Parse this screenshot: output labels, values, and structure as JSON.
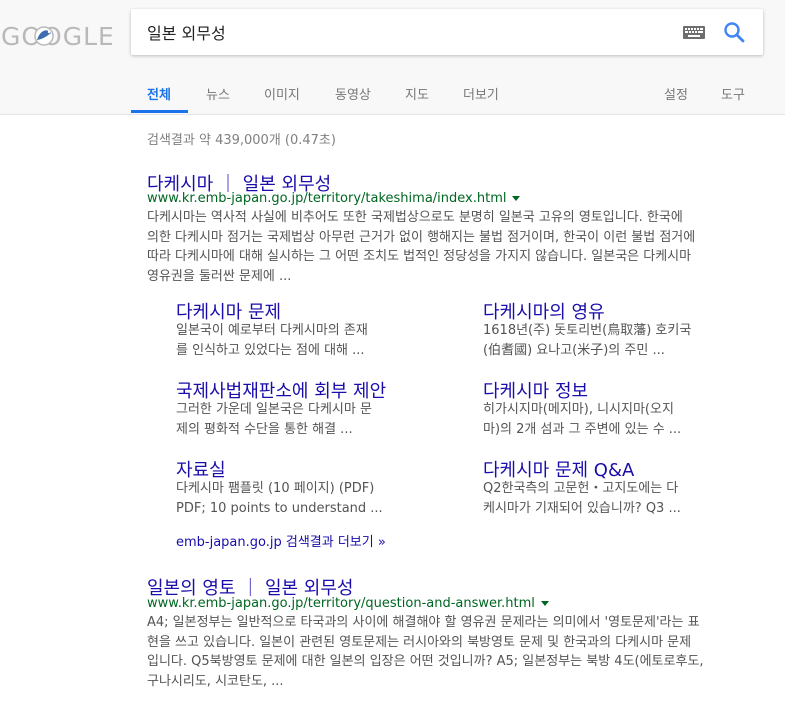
{
  "logo": {
    "text": "GOOGLE"
  },
  "search": {
    "query": "일본 외무성"
  },
  "tabs": [
    {
      "label": "전체",
      "active": true
    },
    {
      "label": "뉴스"
    },
    {
      "label": "이미지"
    },
    {
      "label": "동영상"
    },
    {
      "label": "지도"
    },
    {
      "label": "더보기"
    },
    {
      "label": "설정"
    },
    {
      "label": "도구"
    }
  ],
  "stats": "검색결과 약 439,000개 (0.47초)",
  "results": [
    {
      "title": "다케시마 ｜ 일본 외무성",
      "url": "www.kr.emb-japan.go.jp/territory/takeshima/index.html",
      "snippet": [
        "다케시마는 역사적 사실에 비추어도 또한 국제법상으로도 분명히 일본국 고유의 영토입니다. 한국에",
        "의한 다케시마 점거는 국제법상 아무런 근거가 없이 행해지는 불법 점거이며, 한국이 이런 불법 점거에",
        "따라 다케시마에 대해 실시하는 그 어떤 조치도 법적인 정당성을 가지지 않습니다. 일본국은 다케시마",
        "영유권을 둘러싼 문제에 ..."
      ],
      "sitelinks": [
        {
          "title": "다케시마 문제",
          "desc": [
            "일본국이 예로부터 다케시마의 존재",
            "를 인식하고 있었다는 점에 대해 ..."
          ]
        },
        {
          "title": "다케시마의 영유",
          "desc": [
            "1618년(주) 돗토리번(鳥取藩) 호키국",
            "(伯耆國) 요나고(米子)의 주민 ..."
          ]
        },
        {
          "title": "국제사법재판소에 회부 제안",
          "desc": [
            "그러한 가운데 일본국은 다케시마 문",
            "제의 평화적 수단을 통한 해결 ..."
          ]
        },
        {
          "title": "다케시마 정보",
          "desc": [
            "히가시지마(메지마), 니시지마(오지",
            "마)의 2개 섬과 그 주변에 있는 수 ..."
          ]
        },
        {
          "title": "자료실",
          "desc": [
            "다케시마 팸플릿 (10 페이지) (PDF)",
            "PDF; 10 points to understand ..."
          ]
        },
        {
          "title": "다케시마 문제 Q&A",
          "desc": [
            "Q2한국측의 고문헌・고지도에는 다",
            "케시마가 기재되어 있습니까? Q3 ..."
          ]
        }
      ],
      "more": "emb-japan.go.jp 검색결과 더보기 »"
    },
    {
      "title": "일본의 영토 ｜ 일본 외무성",
      "url": "www.kr.emb-japan.go.jp/territory/question-and-answer.html",
      "snippet": [
        "A4; 일본정부는 일반적으로 타국과의 사이에 해결해야 할 영유권 문제라는 의미에서 '영토문제'라는 표",
        "현을 쓰고 있습니다. 일본이 관련된 영토문제는 러시아와의 북방영토 문제 및 한국과의 다케시마 문제",
        "입니다. Q5북방영토 문제에 대한 일본의 입장은 어떤 것입니까? A5; 일본정부는 북방 4도(에토로후도,",
        "구나시리도, 시코탄도, ..."
      ]
    }
  ],
  "colors": {
    "accent": "#1a73e8",
    "link": "#1a0dab",
    "url": "#006621",
    "snippet": "#545454"
  }
}
